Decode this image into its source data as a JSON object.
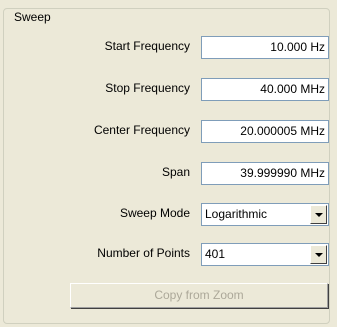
{
  "sweep": {
    "group_title": "Sweep",
    "start_frequency": {
      "label": "Start Frequency",
      "value": "10.000 Hz"
    },
    "stop_frequency": {
      "label": "Stop Frequency",
      "value": "40.000 MHz"
    },
    "center_frequency": {
      "label": "Center Frequency",
      "value": "20.000005 MHz"
    },
    "span": {
      "label": "Span",
      "value": "39.999990 MHz"
    },
    "sweep_mode": {
      "label": "Sweep Mode",
      "value": "Logarithmic"
    },
    "number_of_points": {
      "label": "Number of Points",
      "value": "401"
    },
    "copy_from_zoom": "Copy from Zoom"
  }
}
